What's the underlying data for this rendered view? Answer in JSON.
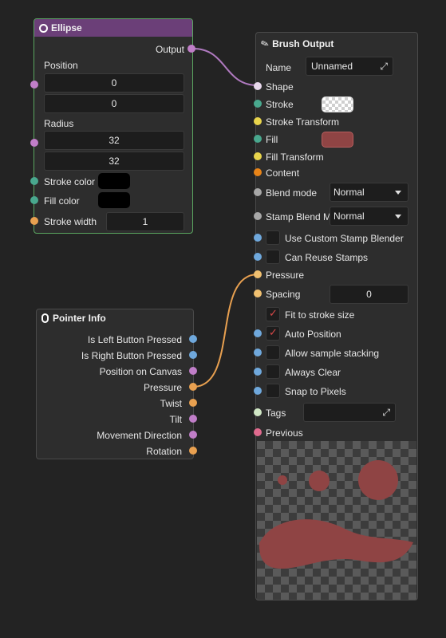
{
  "colors": {
    "background": "#232323",
    "ellipse_header": "#6b3f78",
    "ellipse_border": "#5aa660",
    "port_purple": "#c07ec8",
    "port_green": "#49a88e",
    "port_orange": "#e8a050",
    "port_blue": "#6fa8dc",
    "port_yellow": "#e8d44c",
    "port_dark_orange": "#e88418",
    "port_gray": "#a7a7a7",
    "port_light_green": "#cfe6c4",
    "port_pink": "#e06a8e",
    "fill_color": "#8f4444",
    "wire_purple": "#b07ac0",
    "wire_orange": "#e8a050"
  },
  "ellipse_node": {
    "title": "Ellipse",
    "title_icon": "circle-icon",
    "output_label": "Output",
    "position_label": "Position",
    "position_x": "0",
    "position_y": "0",
    "radius_label": "Radius",
    "radius_x": "32",
    "radius_y": "32",
    "stroke_color_label": "Stroke color",
    "fill_color_label": "Fill color",
    "stroke_width_label": "Stroke width",
    "stroke_width": "1"
  },
  "pointer_node": {
    "title": "Pointer Info",
    "title_icon": "mouse-icon",
    "outputs": [
      "Is Left Button Pressed",
      "Is Right Button Pressed",
      "Position on Canvas",
      "Pressure",
      "Twist",
      "Tilt",
      "Movement Direction",
      "Rotation"
    ]
  },
  "brush_node": {
    "title": "Brush Output",
    "title_icon": "brush-icon",
    "name_label": "Name",
    "name_value": "Unnamed",
    "shape_label": "Shape",
    "stroke_label": "Stroke",
    "stroke_transform_label": "Stroke Transform",
    "fill_label": "Fill",
    "fill_transform_label": "Fill Transform",
    "content_label": "Content",
    "blend_mode_label": "Blend mode",
    "blend_mode_value": "Normal",
    "stamp_blend_label": "Stamp Blend M",
    "stamp_blend_value": "Normal",
    "use_custom_stamp_label": "Use Custom Stamp Blender",
    "can_reuse_label": "Can Reuse Stamps",
    "pressure_label": "Pressure",
    "spacing_label": "Spacing",
    "spacing_value": "0",
    "fit_stroke_label": "Fit to stroke size",
    "auto_position_label": "Auto Position",
    "allow_stacking_label": "Allow sample stacking",
    "always_clear_label": "Always Clear",
    "snap_pixels_label": "Snap to Pixels",
    "tags_label": "Tags",
    "previous_label": "Previous",
    "checks": {
      "use_custom_stamp": false,
      "can_reuse": false,
      "fit_stroke": true,
      "auto_position": true,
      "allow_stacking": false,
      "always_clear": false,
      "snap_pixels": false
    }
  }
}
